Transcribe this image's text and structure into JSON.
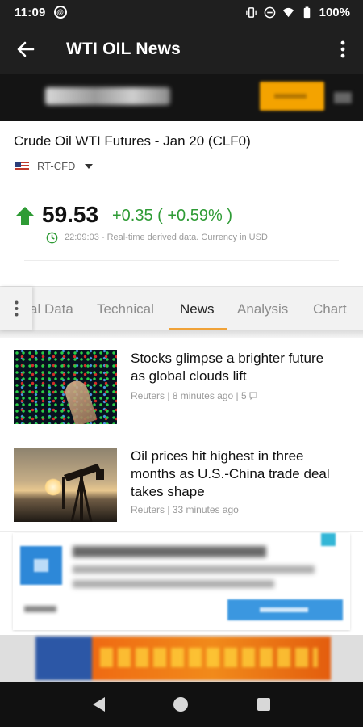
{
  "status_bar": {
    "time": "11:09",
    "battery": "100%",
    "icons": [
      "vibrate-icon",
      "do-not-disturb-icon",
      "wifi-icon",
      "battery-icon"
    ]
  },
  "app_bar": {
    "title": "WTI OIL News",
    "back_icon": "arrow-left-icon",
    "menu_icon": "more-vert-icon"
  },
  "instrument": {
    "name": "Crude Oil WTI Futures - Jan 20 (CLF0)",
    "exchange": "RT-CFD"
  },
  "quote": {
    "last": "59.53",
    "change": "+0.35 ( +0.59% )",
    "direction": "up",
    "timestamp": "22:09:03",
    "note": "- Real-time derived data. Currency in USD",
    "color_up": "#2e9b35"
  },
  "tabs": {
    "items": [
      {
        "label": "al Data"
      },
      {
        "label": "Technical"
      },
      {
        "label": "News"
      },
      {
        "label": "Analysis"
      },
      {
        "label": "Chart"
      }
    ],
    "active": "News",
    "accent": "#f0a238"
  },
  "news": [
    {
      "headline_line1": "Stocks glimpse a brighter future",
      "headline_line2": "as global clouds lift",
      "source": "Reuters | 8 minutes ago | 5"
    },
    {
      "headline_line1": "Oil prices hit highest in three",
      "headline_line2": "months as U.S.-China trade deal",
      "headline_line3": "takes shape",
      "source": "Reuters | 33 minutes ago"
    }
  ]
}
